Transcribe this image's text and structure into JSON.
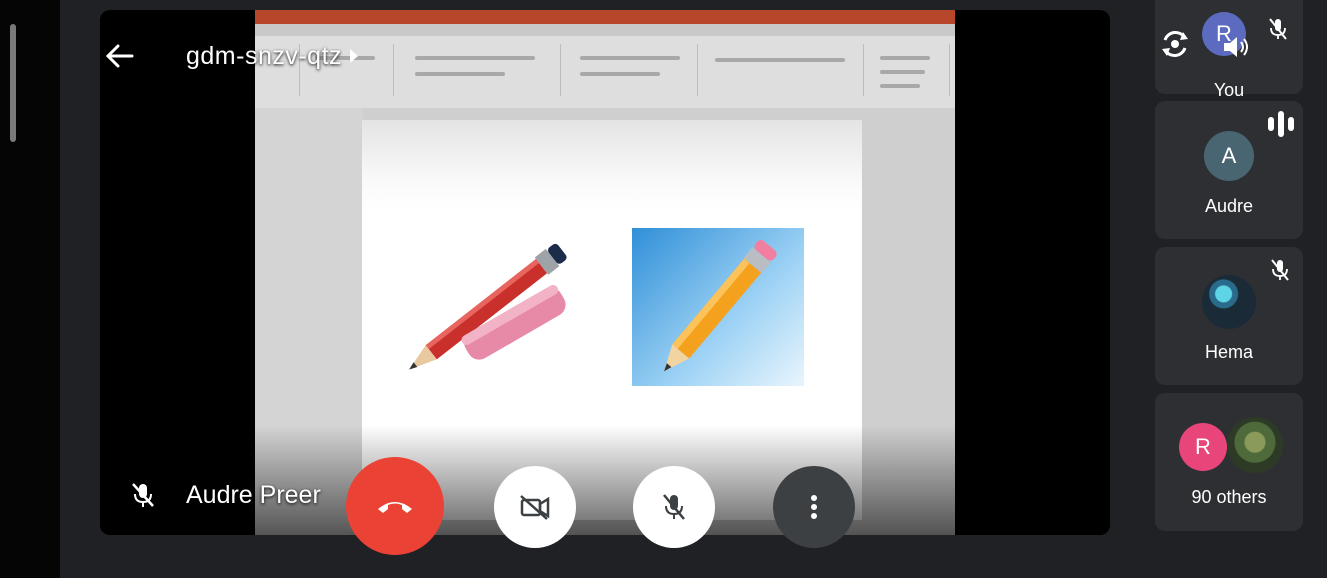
{
  "meeting": {
    "code": "gdm-snzv-qtz",
    "presenter_name": "Audre Preer"
  },
  "participants": [
    {
      "name": "You",
      "initial": "R",
      "avatar_color": "#5c6bc0",
      "status": "muted, speaker on"
    },
    {
      "name": "Audre",
      "initial": "A",
      "avatar_color": "#4a6572",
      "status": "speaking"
    },
    {
      "name": "Hema",
      "initial": "",
      "avatar_color": "#1f3340",
      "status": "muted"
    }
  ],
  "others": {
    "label": "90 others",
    "initial": "R",
    "avatar_color": "#e8457a"
  },
  "controls": {
    "hangup_color": "#ea4335",
    "icons": [
      "back-arrow-icon",
      "chevron-right-icon",
      "rotate-camera-icon",
      "speaker-icon",
      "mic-off-icon",
      "audio-level-icon",
      "phone-hangup-icon",
      "video-off-icon",
      "more-vertical-icon"
    ]
  }
}
